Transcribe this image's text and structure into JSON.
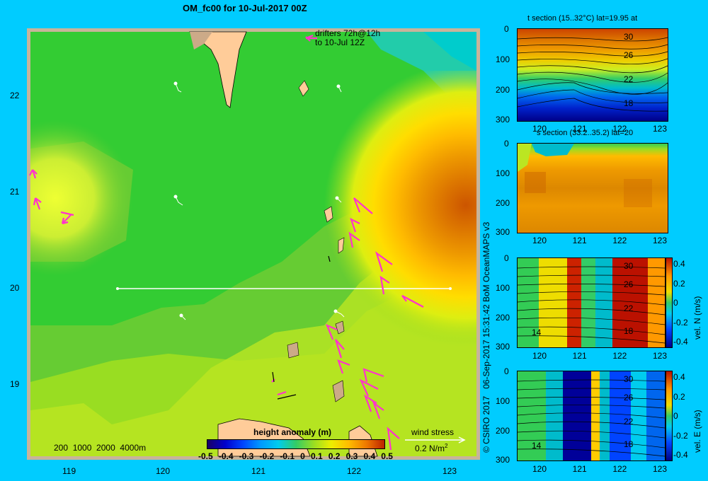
{
  "main_map": {
    "title": "OM_fc00 for 10-Jul-2017 00Z",
    "drifters_line1": "drifters 72h@12h",
    "drifters_line2": "to 10-Jul 12Z",
    "depth_scale_label": "200  1000  2000  4000m",
    "colorbar_title": "height anomaly (m)",
    "colorbar_ticks": [
      "-0.5",
      "-0.4",
      "-0.3",
      "-0.2",
      "-0.1",
      "0",
      "0.1",
      "0.2",
      "0.3",
      "0.4",
      "0.5"
    ],
    "wind_stress_label": "wind stress",
    "wind_stress_value": "0.2 N/m",
    "wind_stress_exponent": "2",
    "lon_ticks": [
      "119",
      "120",
      "121",
      "122",
      "123"
    ],
    "lat_ticks": [
      "22",
      "21",
      "20",
      "19"
    ],
    "section_line_lat": 20,
    "section_line_lon": [
      119.5,
      123.3
    ]
  },
  "credit": "© CSIRO 2017   06-Sep-2017 15:31:42 BoM OceanMAPS v3",
  "panels": [
    {
      "name": "t-section",
      "title": "t section (15..32°C) lat=19.95 at",
      "y_ticks": [
        "0",
        "100",
        "200",
        "300"
      ],
      "x_ticks": [
        "120",
        "121",
        "122",
        "123"
      ],
      "contour_labels": [
        "30",
        "26",
        "22",
        "18"
      ],
      "has_colorbar": false
    },
    {
      "name": "s-section",
      "title": "s section (33.2..35.2) lat=20",
      "y_ticks": [
        "0",
        "100",
        "200",
        "300"
      ],
      "x_ticks": [
        "120",
        "121",
        "122",
        "123"
      ],
      "contour_labels": [],
      "has_colorbar": false
    },
    {
      "name": "vel-n-section",
      "title": "",
      "y_ticks": [
        "0",
        "100",
        "200",
        "300"
      ],
      "x_ticks": [
        "120",
        "121",
        "122",
        "123"
      ],
      "contour_labels": [
        "30",
        "26",
        "22",
        "18",
        "14"
      ],
      "has_colorbar": true,
      "colorbar_ticks": [
        "0.4",
        "0.2",
        "0",
        "-0.2",
        "-0.4"
      ],
      "colorbar_label": "vel. N (m/s)"
    },
    {
      "name": "vel-e-section",
      "title": "",
      "y_ticks": [
        "0",
        "100",
        "200",
        "300"
      ],
      "x_ticks": [
        "120",
        "121",
        "122",
        "123"
      ],
      "contour_labels": [
        "30",
        "26",
        "22",
        "18",
        "14"
      ],
      "has_colorbar": true,
      "colorbar_ticks": [
        "0.4",
        "0.2",
        "0",
        "-0.2",
        "-0.4"
      ],
      "colorbar_label": "vel. E (m/s)"
    }
  ],
  "colors": {
    "background": "#00ccff",
    "map_green": "#33cc33",
    "land": "#ffcc99",
    "shelf": "#ccaa88",
    "wind_vector": "#ff33cc",
    "frame": "#c8b49a"
  }
}
